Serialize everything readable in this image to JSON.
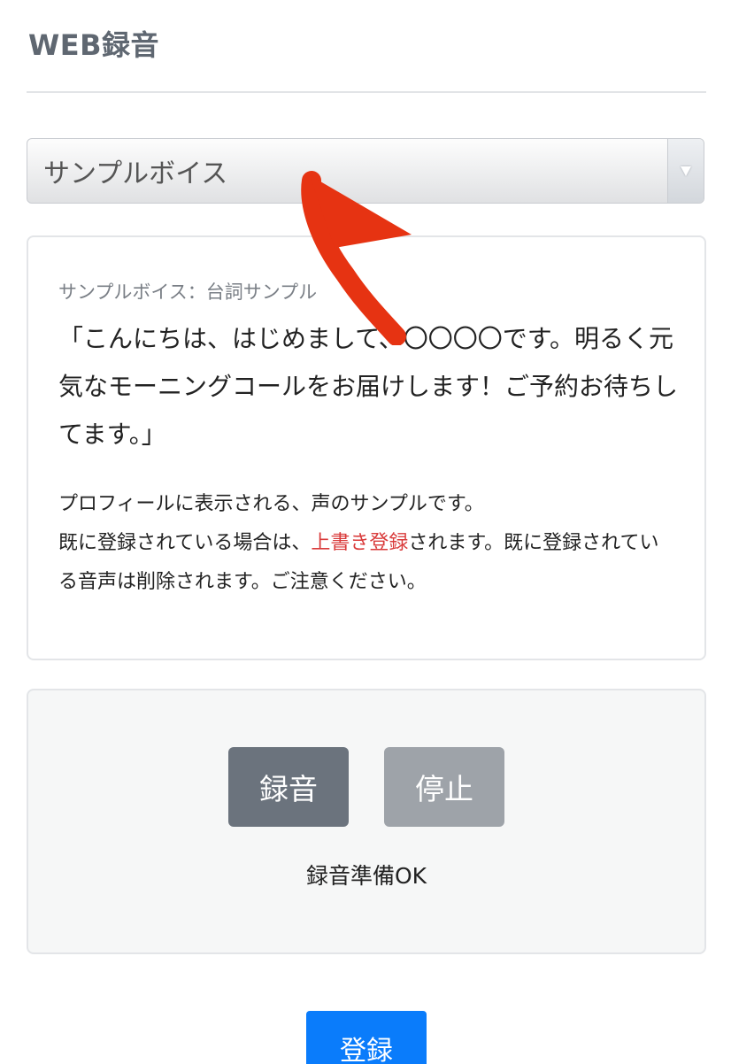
{
  "header": {
    "title": "WEB録音"
  },
  "voice_select": {
    "selected": "サンプルボイス"
  },
  "sample_card": {
    "caption": "サンプルボイス：台詞サンプル",
    "script": "「こんにちは、はじめまして、〇〇〇〇です。明るく元気なモーニングコールをお届けします！ご予約お待ちしてます。」",
    "notice_line1": "プロフィールに表示される、声のサンプルです。",
    "notice_pre": "既に登録されている場合は、",
    "notice_highlight": "上書き登録",
    "notice_post": "されます。既に登録されている音声は削除されます。ご注意ください。"
  },
  "recorder": {
    "record_label": "録音",
    "stop_label": "停止",
    "status": "録音準備OK"
  },
  "footer": {
    "register_label": "登録"
  },
  "colors": {
    "highlight": "#d93a3a",
    "primary": "#0a7cfb",
    "annotation_arrow": "#e63312"
  }
}
